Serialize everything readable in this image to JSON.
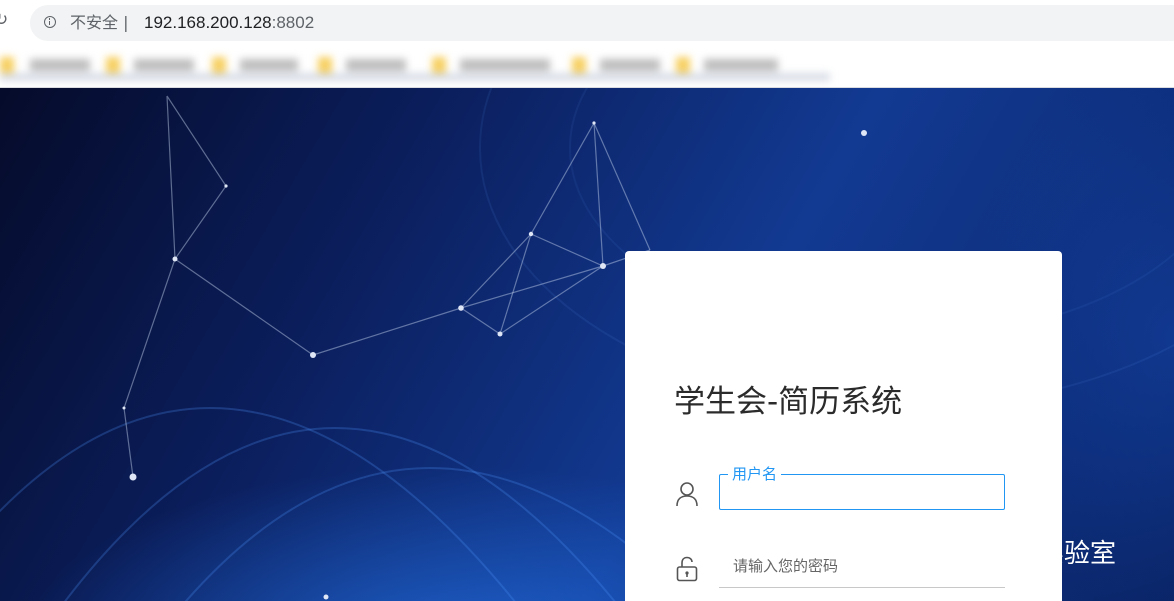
{
  "browser": {
    "security_label": "不安全",
    "separator": "|",
    "url_host": "192.168.200.128",
    "url_port": ":8802"
  },
  "login": {
    "title": "学生会-简历系统",
    "username_label": "用户名",
    "password_placeholder": "请输入您的密码"
  },
  "watermark": {
    "text": "字节脉搏实验室"
  },
  "colors": {
    "accent": "#2196f3",
    "background_dark": "#0b1e5c",
    "background_mid": "#123a92",
    "card": "#ffffff"
  },
  "icons": {
    "reload": "reload-icon",
    "info": "info-icon",
    "user": "user-icon",
    "lock": "lock-icon",
    "wechat": "wechat-icon"
  }
}
